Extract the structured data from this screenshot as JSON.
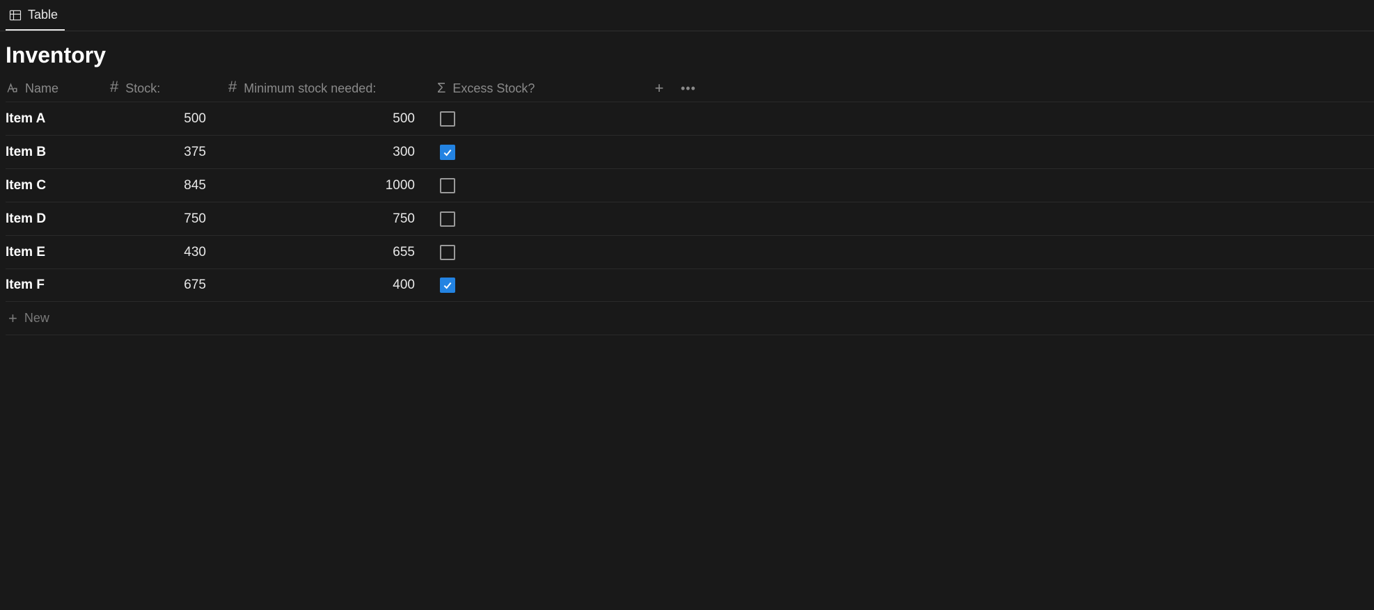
{
  "tabs": {
    "table_label": "Table"
  },
  "page": {
    "title": "Inventory"
  },
  "columns": {
    "name": "Name",
    "stock": "Stock:",
    "min_stock": "Minimum stock needed:",
    "excess": "Excess Stock?"
  },
  "rows": [
    {
      "name": "Item A",
      "stock": "500",
      "min": "500",
      "excess": false
    },
    {
      "name": "Item B",
      "stock": "375",
      "min": "300",
      "excess": true
    },
    {
      "name": "Item C",
      "stock": "845",
      "min": "1000",
      "excess": false
    },
    {
      "name": "Item D",
      "stock": "750",
      "min": "750",
      "excess": false
    },
    {
      "name": "Item E",
      "stock": "430",
      "min": "655",
      "excess": false
    },
    {
      "name": "Item F",
      "stock": "675",
      "min": "400",
      "excess": true
    }
  ],
  "actions": {
    "new_label": "New"
  }
}
